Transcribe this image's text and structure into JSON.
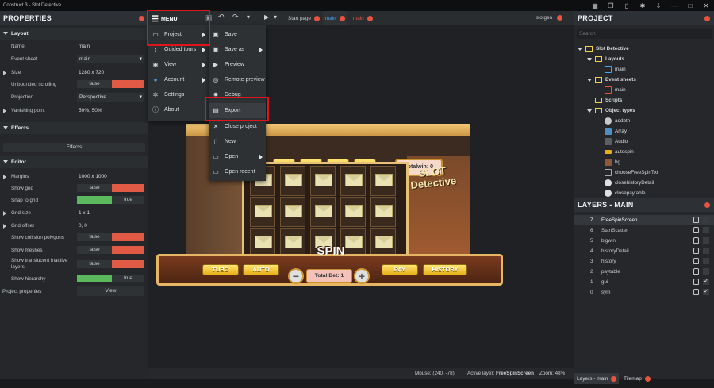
{
  "window": {
    "title": "Construct 3 - Slot Detective"
  },
  "toolbar": {
    "menu_label": "MENU",
    "tabs": [
      {
        "label": "Start page"
      },
      {
        "label": "main"
      },
      {
        "label": "main"
      }
    ],
    "user": "slotgen"
  },
  "main_menu": {
    "items": [
      {
        "label": "Project",
        "icon": "project-icon"
      },
      {
        "label": "Guided tours",
        "icon": "guided-tours-icon"
      },
      {
        "label": "View",
        "icon": "eye-icon"
      },
      {
        "label": "Account",
        "icon": "account-icon"
      },
      {
        "label": "Settings",
        "icon": "gear-icon"
      },
      {
        "label": "About",
        "icon": "info-icon"
      }
    ]
  },
  "project_menu": {
    "items": [
      {
        "label": "Save"
      },
      {
        "label": "Save as"
      },
      {
        "label": "Preview"
      },
      {
        "label": "Remote preview"
      },
      {
        "label": "Debug"
      },
      {
        "label": "Export"
      },
      {
        "label": "Close project"
      },
      {
        "label": "New"
      },
      {
        "label": "Open"
      },
      {
        "label": "Open recent"
      }
    ]
  },
  "properties": {
    "title": "PROPERTIES",
    "layout_section": "Layout",
    "name_label": "Name",
    "name_value": "main",
    "event_sheet_label": "Event sheet",
    "event_sheet_value": "main",
    "size_label": "Size",
    "size_value": "1280 x 720",
    "unbounded_label": "Unbounded scrolling",
    "unbounded_value": "false",
    "projection_label": "Projection",
    "projection_value": "Perspective",
    "vanishing_label": "Vanishing point",
    "vanishing_value": "50%, 50%",
    "effects_section": "Effects",
    "effects_button": "Effects",
    "editor_section": "Editor",
    "margins_label": "Margins",
    "margins_value": "1000 x 1000",
    "show_grid_label": "Show grid",
    "show_grid_value": "false",
    "snap_label": "Snap to grid",
    "snap_value": "true",
    "grid_size_label": "Grid size",
    "grid_size_value": "1 x 1",
    "grid_offset_label": "Grid offset",
    "grid_offset_value": "0, 0",
    "collision_label": "Show collision polygons",
    "collision_value": "false",
    "meshes_label": "Show meshes",
    "meshes_value": "false",
    "translucent_label": "Show translucent inactive layers",
    "translucent_value": "false",
    "hierarchy_label": "Show hierarchy",
    "hierarchy_value": "true",
    "project_props_label": "Project properties",
    "project_props_button": "View"
  },
  "project_panel": {
    "title": "PROJECT",
    "search_placeholder": "Search",
    "root": "Slot Detective",
    "layouts_folder": "Layouts",
    "layout_main": "main",
    "event_sheets_folder": "Event sheets",
    "event_sheet_main": "main",
    "scripts_folder": "Scripts",
    "object_types_folder": "Object types",
    "objects": [
      "addbtn",
      "Array",
      "Audio",
      "autospin",
      "bg",
      "chooseFreeSpinTxt",
      "closehistoryDetail",
      "closepaytable"
    ]
  },
  "layers_panel": {
    "title": "LAYERS - MAIN",
    "layers": [
      {
        "index": "7",
        "name": "FreeSpinScreen",
        "visible": ""
      },
      {
        "index": "6",
        "name": "StartScatter",
        "visible": ""
      },
      {
        "index": "5",
        "name": "bigwin",
        "visible": ""
      },
      {
        "index": "4",
        "name": "historyDetail",
        "visible": ""
      },
      {
        "index": "3",
        "name": "history",
        "visible": ""
      },
      {
        "index": "2",
        "name": "paytable",
        "visible": ""
      },
      {
        "index": "1",
        "name": "gui",
        "visible": "✓"
      },
      {
        "index": "0",
        "name": "sym",
        "visible": "✓"
      }
    ]
  },
  "bottom_tabs": {
    "layers": "Layers - main",
    "tilemap": "Tilemap"
  },
  "status": {
    "mouse": "Mouse: (240, -78)",
    "active_layer_label": "Active layer:",
    "active_layer_value": "FreeSpinScreen",
    "zoom": "Zoom: 48%"
  },
  "game": {
    "multipliers": [
      "x1",
      "x2",
      "x3",
      "x5"
    ],
    "total_win": "Totalwin: 0",
    "title_logo": "SLOT Detective",
    "spin_label": "SPIN",
    "total_bet": "Total Bet: 1",
    "buttons": [
      "TUBO",
      "AUTO",
      "PAY",
      "HISTORY"
    ]
  },
  "colors": {
    "accent": "#3fa9f5",
    "close_dot": "#e8533f",
    "highlight": "#e0141b",
    "true_green": "#5cb85c",
    "false_red": "#e05a46"
  }
}
